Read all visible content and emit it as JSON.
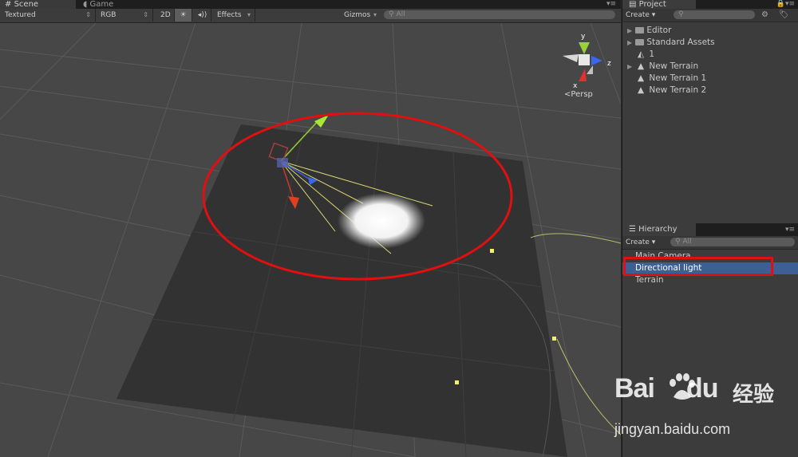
{
  "scene_window": {
    "tabs": [
      {
        "icon": "grid-icon",
        "label": "Scene"
      },
      {
        "icon": "pacman-icon",
        "label": "Game"
      }
    ],
    "toolbar": {
      "render_mode": "Textured",
      "color_mode": "RGB",
      "mode_2d": "2D",
      "light_icon": "☀",
      "audio_icon": "◂))",
      "effects": "Effects",
      "gizmos": "Gizmos",
      "search_placeholder": "All"
    },
    "gizmo": {
      "y_label": "y",
      "z_label": "z",
      "x_label": "x",
      "persp_label": "Persp"
    }
  },
  "project_panel": {
    "tab_label": "Project",
    "create_label": "Create",
    "items": [
      {
        "label": "Editor",
        "icon": "folder-icon",
        "arrow": true
      },
      {
        "label": "Standard Assets",
        "icon": "folder-icon",
        "arrow": true
      },
      {
        "label": "1",
        "icon": "unity-scene-icon",
        "arrow": false
      },
      {
        "label": "New Terrain",
        "icon": "terrain-icon",
        "arrow": true
      },
      {
        "label": "New Terrain 1",
        "icon": "terrain-icon",
        "arrow": false
      },
      {
        "label": "New Terrain 2",
        "icon": "terrain-icon",
        "arrow": false
      }
    ]
  },
  "hierarchy_panel": {
    "tab_label": "Hierarchy",
    "create_label": "Create",
    "search_placeholder": "All",
    "items": [
      {
        "label": "Main Camera",
        "selected": false
      },
      {
        "label": "Directional light",
        "selected": true
      },
      {
        "label": "Terrain",
        "selected": false
      }
    ]
  },
  "watermark": {
    "brand_left": "Bai",
    "brand_right": "du",
    "brand_cn": "经验",
    "url": "jingyan.baidu.com"
  },
  "colors": {
    "selection": "#3e5f96",
    "annotation_red": "#e01010",
    "light_gizmo": "#e6e67a"
  }
}
